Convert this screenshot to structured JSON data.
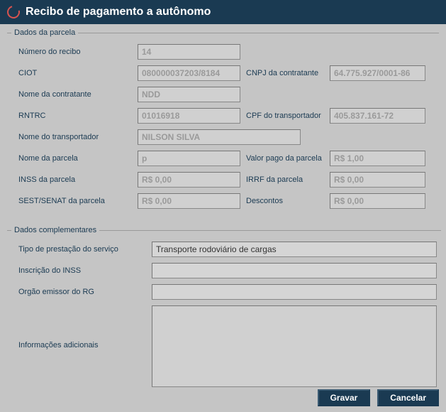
{
  "header": {
    "title": "Recibo de pagamento a autônomo"
  },
  "parcela": {
    "legend": "Dados da parcela",
    "numero_recibo_label": "Número do recibo",
    "numero_recibo": "14",
    "ciot_label": "CIOT",
    "ciot": "080000037203/8184",
    "cnpj_contratante_label": "CNPJ da contratante",
    "cnpj_contratante": "64.775.927/0001-86",
    "nome_contratante_label": "Nome da contratante",
    "nome_contratante": "NDD",
    "rntrc_label": "RNTRC",
    "rntrc": "01016918",
    "cpf_transportador_label": "CPF do transportador",
    "cpf_transportador": "405.837.161-72",
    "nome_transportador_label": "Nome do transportador",
    "nome_transportador": "NILSON SILVA",
    "nome_parcela_label": "Nome da parcela",
    "nome_parcela": "p",
    "valor_pago_label": "Valor pago da parcela",
    "valor_pago": "R$ 1,00",
    "inss_parcela_label": "INSS da parcela",
    "inss_parcela": "R$ 0,00",
    "irrf_parcela_label": "IRRF da parcela",
    "irrf_parcela": "R$ 0,00",
    "sest_senat_label": "SEST/SENAT da parcela",
    "sest_senat": "R$ 0,00",
    "descontos_label": "Descontos",
    "descontos": "R$ 0,00"
  },
  "complementares": {
    "legend": "Dados complementares",
    "tipo_prestacao_label": "Tipo de prestação do serviço",
    "tipo_prestacao": "Transporte rodoviário de cargas",
    "inscricao_inss_label": "Inscrição do INSS",
    "inscricao_inss": "",
    "orgao_emissor_label": "Orgão emissor do RG",
    "orgao_emissor": "",
    "info_adicionais_label": "Informações adicionais",
    "info_adicionais": ""
  },
  "footer": {
    "gravar": "Gravar",
    "cancelar": "Cancelar"
  }
}
